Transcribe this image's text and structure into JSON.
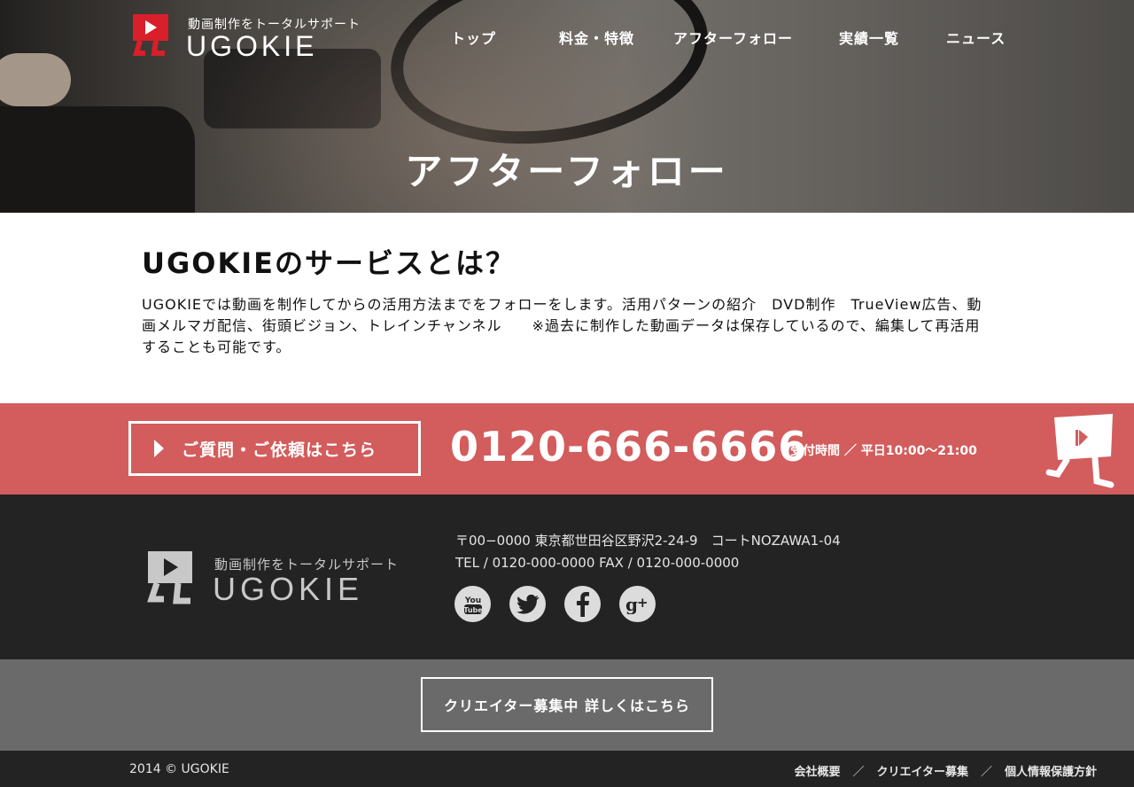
{
  "header": {
    "logo_tagline": "動画制作をトータルサポート",
    "logo_name": "UGOKIE",
    "nav": [
      "トップ",
      "料金・特徴",
      "アフターフォロー",
      "実績一覧",
      "ニュース"
    ],
    "page_title": "アフターフォロー"
  },
  "main": {
    "heading": "UGOKIEのサービスとは？",
    "body": "UGOKIEでは動画を制作してからの活用方法までをフォローをします。活用パターンの紹介　DVD制作　TrueView広告、動画メルマガ配信、街頭ビジョン、トレインチャンネル　　※過去に制作した動画データは保存しているので、編集して再活用することも可能です。"
  },
  "contact": {
    "button_label": "ご質問・ご依頼はこちら",
    "phone": "0120-666-6666",
    "hours": "受付時間 ／ 平日10:00〜21:00"
  },
  "footer": {
    "logo_tagline": "動画制作をトータルサポート",
    "logo_name": "UGOKIE",
    "address": "〒00−0000 東京都世田谷区野沢2-24-9　コートNOZAWA1-04",
    "tel_fax": "TEL / 0120-000-0000  FAX / 0120-000-0000",
    "social": [
      "youtube-icon",
      "twitter-icon",
      "facebook-icon",
      "google-plus-icon"
    ],
    "recruit_button": "クリエイター募集中 詳しくはこちら",
    "copyright": "2014 © UGOKIE",
    "links": [
      "会社概要",
      "クリエイター募集",
      "個人情報保護方針"
    ],
    "link_separator": "／"
  },
  "colors": {
    "brand_red": "#d81f2a",
    "contact_band": "#d35c5c",
    "footer_dark": "#232323",
    "recruit_gray": "#6a6a6a"
  }
}
